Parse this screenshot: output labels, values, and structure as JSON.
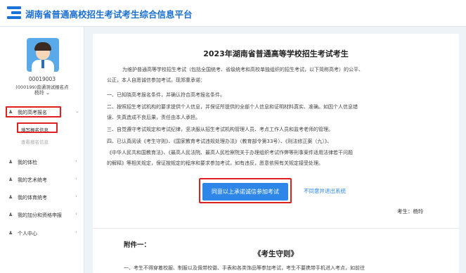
{
  "header": {
    "title": "湖南省普通高校招生考试考生综合信息平台"
  },
  "user": {
    "id": "00019003",
    "school": "(000199)普通测试报名点",
    "name": "杨玲"
  },
  "sidebar": {
    "items": [
      {
        "label": "我的高考报名",
        "arrow": "⌄",
        "subitems": [
          {
            "label": "填写报名信息"
          },
          {
            "label": "查看报名信息"
          }
        ]
      },
      {
        "label": "我的体检",
        "arrow": "‹"
      },
      {
        "label": "我的艺术统考",
        "arrow": "‹"
      },
      {
        "label": "我的体育统考",
        "arrow": "‹"
      },
      {
        "label": "我的加分和资格申报",
        "arrow": "‹"
      },
      {
        "label": "个人中心",
        "arrow": "‹"
      }
    ]
  },
  "notice": {
    "title": "2023年湖南省普通高等学校招生考试考生",
    "intro_1": "为维护普通高等学校招生考试（包括全国统考、省级统考和高校单独组织的招生考试，以下简称高考）的公平、",
    "intro_2": "公正，本人自愿诚信参加考试。现郑重承诺：",
    "items": [
      "一、已知晓高考报名条件，并确认符合高考报名条件。",
      "二、按照招生考试机构的要求提供个人信息，并保证所提供的全部个人信息和证明材料真实、准确。如因个人信息错",
      "误、失真造成不良后果，责任由本人承担。",
      "三、自觉遵守考试规定和考试纪律，坚决服从招生考试机构管理人员、考点工作人员和监考老师的管理。",
      "四、已认真阅读《考生守则》、《国家教育考试违规处理办法》（教育部令第33号）、《刑法修正案（九）》、",
      "《中华人民共和国教育法》、《最高人民法院、最高人民检察院关于办理组织考试作弊等刑事案件适用法律若干问题",
      "的解释》等相关规定，保证按规定的程序和要求参加考试，如有违反，愿意依照有关规定接受处理。"
    ],
    "agree_button": "同意以上承诺诚信参加考试",
    "disagree_link": "不同意并退出系统",
    "signature": "考生：杨玲"
  },
  "attachment": {
    "label": "附件一：",
    "doc_title": "《考生守则》",
    "first_line": "一、考生不得穿着校服、制服以及佩带校徽、手表和各类饰品等参加考试，考生不要携带手机进入考点，如前往"
  },
  "colors": {
    "brand": "#1a6fd0",
    "button": "#2d86e8",
    "highlight": "#e02020"
  }
}
